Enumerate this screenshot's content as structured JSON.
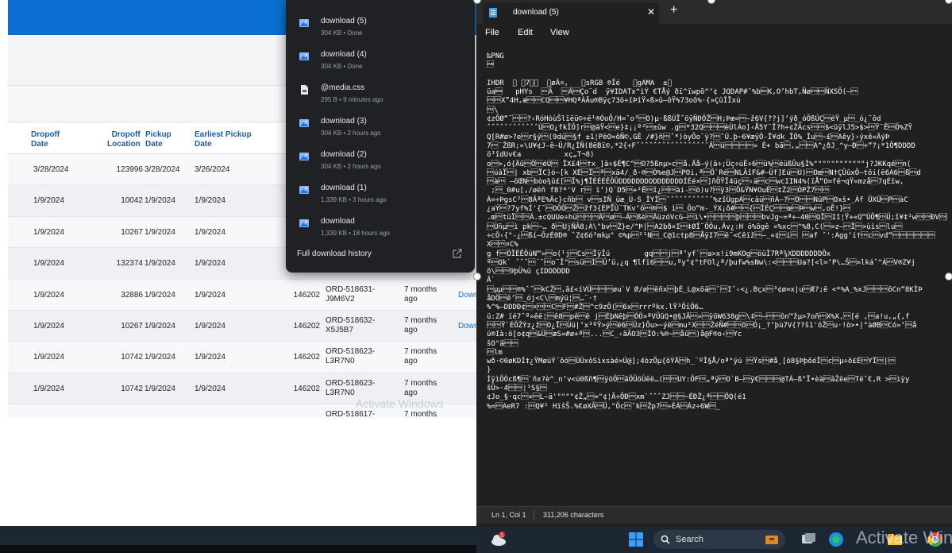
{
  "web_table": {
    "headers": {
      "dropoff_date": "Dropoff\nDate",
      "dropoff_location": "Dropoff\nLocation",
      "pickup_date": "Pickup\nDate",
      "earliest_pickup": "Earliest Pickup\nDate"
    },
    "rows": [
      {
        "dropoff_date": "3/28/2024",
        "location": "123996",
        "pickup_date": "3/28/2024",
        "earliest": "3/26/2024",
        "code": "",
        "order": "",
        "age": "",
        "action": ""
      },
      {
        "dropoff_date": "1/9/2024",
        "location": "10042",
        "pickup_date": "1/9/2024",
        "earliest": "1/9/2024",
        "code": "",
        "order": "",
        "age": "",
        "action": ""
      },
      {
        "dropoff_date": "1/9/2024",
        "location": "10267",
        "pickup_date": "1/9/2024",
        "earliest": "1/9/2024",
        "code": "",
        "order": "",
        "age": "",
        "action": ""
      },
      {
        "dropoff_date": "1/9/2024",
        "location": "132374",
        "pickup_date": "1/9/2024",
        "earliest": "1/9/2024",
        "code": "",
        "order": "",
        "age": "",
        "action": ""
      },
      {
        "dropoff_date": "1/9/2024",
        "location": "32886",
        "pickup_date": "1/9/2024",
        "earliest": "1/9/2024",
        "code": "146202",
        "order": "ORD-518631-\nJ9M6V2",
        "age": "7 months\nago",
        "action": "Down"
      },
      {
        "dropoff_date": "1/9/2024",
        "location": "10267",
        "pickup_date": "1/9/2024",
        "earliest": "1/9/2024",
        "code": "146202",
        "order": "ORD-518632-\nX5J5B7",
        "age": "7 months\nago",
        "action": "Down"
      },
      {
        "dropoff_date": "1/9/2024",
        "location": "10742",
        "pickup_date": "1/9/2024",
        "earliest": "1/9/2024",
        "code": "146202",
        "order": "ORD-518623-\nL3R7N0",
        "age": "7 months\nago",
        "action": ""
      },
      {
        "dropoff_date": "1/9/2024",
        "location": "10742",
        "pickup_date": "1/9/2024",
        "earliest": "1/9/2024",
        "code": "146202",
        "order": "ORD-518623-\nL3R7N0",
        "age": "7 months\nago",
        "action": ""
      },
      {
        "dropoff_date": "",
        "location": "",
        "pickup_date": "",
        "earliest": "",
        "code": "",
        "order": "ORD-518617-",
        "age": "7 months",
        "action": ""
      }
    ],
    "watermark": "Activate Windows"
  },
  "downloads": {
    "items": [
      {
        "name": "download (5)",
        "meta": "304 KB • Done",
        "icon": "image-file-icon"
      },
      {
        "name": "download (4)",
        "meta": "304 KB • Done",
        "icon": "image-file-icon"
      },
      {
        "name": "@media.css",
        "meta": "295 B • 9 minutes ago",
        "icon": "css-file-icon"
      },
      {
        "name": "download (3)",
        "meta": "304 KB • 2 hours ago",
        "icon": "image-file-icon"
      },
      {
        "name": "download (2)",
        "meta": "304 KB • 2 hours ago",
        "icon": "image-file-icon"
      },
      {
        "name": "download (1)",
        "meta": "1,339 KB • 3 hours ago",
        "icon": "image-file-icon"
      },
      {
        "name": "download",
        "meta": "1,339 KB • 18 hours ago",
        "icon": "image-file-icon"
      }
    ],
    "history_label": "Full download history"
  },
  "notepad": {
    "tab_title": "download (5)",
    "menu": {
      "file": "File",
      "edit": "Edit",
      "view": "View"
    },
    "content": "‰PNG\n\u001a\n\nIHDR  \u0000 \u00007\u0000\u0000  \u0000øÂ¤,   \u0000sRGB ®Îé   \u0000gAMA  ±\u000f\nüa\u0005   pHYs  \u000eÃ  \u000eÃ\u0001Ço¨d  ÿ¥IDATx^ìÝ €TÅý ðï^ïwpõ^‘¢ JQDAP#ˆ%b\u0006K,O’hbT,Ñø\u0002\u0003ÑXSÕ(–\u0002\n\u0002\u0002X”4H,æ\u0002\u0002CQ\u0002\u0003¥HQªÀÄu®Bÿç73ö÷ïÞîŸ»ß»û–ôŸ%73oõ%·{»ÇûÎÏxú\n\u0002\\\n¢zÕØ“˜\u0002\u0002?›RóHòùŠlïëü©÷ë¹®ÓoÕ/H=ˆo³\u0002O)µ·ßßÚÏˆöÿÑÐÖŽ\u0002H;Þæ=\u0002–ž6V{??j]‘ýð_óÕßÚÇ\u0002éŸ_µ\u0002_ó¿˜ôd\nˆˆˆˆˆˆˆˆˆˆˆˆÚ\u0002O¿fkÎÕ]r\u0002@äŸ<\u0002e}‡¡¡º²\u0002±ûw .g\u0002*32Q\u0002\u0002\u0001èÙlÀo]‹Å5Y¨Î?h÷¢ŽÃcs\u0002\u0002$<üÿlJ5>$>\u0002Ÿ¨Ê\u0002Ö%ZŸ\nQ[R#ø>?e\u0002r§ý\u0002(9dú\u0002§f ±1¦PèO=ôÑ©,GÊ /#}ñ\u0002ˆ*)òyÕo¨ÿ?\u0002ˆÚ.þ~6¥æÿÓ-Ï¥dk_ÏÒ%_Îu\u0002~£\u0002Aêy}›ýxê«ÂýÞ\n7\u0002¨ŽßR;«\\U¥¢J-ê—Ù/R¿ÍÑ(8ëBï©,*2{÷FˆˆˆˆˆˆˆˆˆˆˆˆˆˆˆˆˆÂ\u0002ü\u0002\u0002\u0002\u0002» È+ bã\u0002‚„\u0002\u0002A^¿ðJ_^y—Ð\u0002÷“?¡*1Ô¶DDDD\nö³îdUv€a          xç„T¬8)\no\u0002>,ó{Äû\u0002Ô\u0002éÙ\u0002 ÏX£4\u0002†x_]ä÷$É¶C^\u0002O?5ßnµ>c\u0002å.Äå–ý(ä÷;Üç÷úÊ÷6\u0002ü%\u0002éüßÛu§Í%\"\"\"\"\"\"\"\"\"\"\"\"j?JKKqé\u0002n(\n\u0002úâÏ\u0002| xb\u0002ÏC}ó~[k XÉ\u0002Ï\u0002ª\u0002xä4/_ð·®\u0002Ò%e@J\u0002POi,ª\u0002Õ`Ré\u0002NLÃîF&#–Üf]Eú\u0002Ù)\u0002Oœ\u0002N†ÇÛûxÔ–tôi(ë6A6\u0002ß\u0002d\n\u0002à\u0002 –õŒN\u0002bòo¾û£[\u0002Ï%j¶ÏÈÉÉÊÔÛDDDDDDDDDDDDDDDÍÉé×\u0002]ñÕŸÎ4üç\u0002‹ä\u0002c\u0002wcIIN4%(ïÅ“O=fë¬qŸ«mzå\u00027qÉîw,\n ;\u0002_0#u[,/øëñ f8?*'V r\u0002 ï‘)Q`D5\u0002+²Ê\u0002î¿\u0002\u0002ài-\u0002ò)u?\u0002ÿ3\u0002Ö&ŸN¥OuÊ\u0002‡Ž2\u0002ÒPŽ7\u0002\u0002\nÀ=÷ÞgsC²\u00028ÃªE%Äc}cñb\u0002 v\u0002sIÑ_üæ_Ù-S_ÎYÎ\u0002ˆˆˆˆˆˆˆˆˆˆˆ%zîÜgpÁ\u0002cäü\u0002ñÀ—?\u0002Ò\u0002\u0002NûP\u0002Oxš•_Áf ÜXÚ\u0002P\u0002àC\n¿aÝ\u0002?7yf%Í'{˜\u0002OÕÔ\u0002Ž\u0002žf3{ÈPÏÙ¨TKv‘ô\u0002®\u0002$ ì\u0002_Ôo™m-_ÝX¡ô#\u0002\u0002{\u0002ÎÉÇ\u0002\u0002œ\u0002Þ\u0002w\u0002,oÊ!}\u0002\n.œ\u0002tüÏ\u0002\u0002Á.±cQUUe÷hü\u0002\u0002\u0002Ä\u0002ø\u0002–Á\u0002ßè\u0002ÄüzóVcG–\u0002ì\\•\u0002\u0002\u0002\u0002þ\u0002\u0002\u0002bvJg~=ª+–40\u0002QÏ\u0002Iî¦Ÿ+«Q™ÙÕ¶\u0002Ü;î¥‡¹w\u0002\u0002ÐV\u0002\u0002\u0002ÖNY\n\u0002Ùñµ\u0002ì pk\u0002~… ð\u0002UjÑÃ8;À\\\"bv\u0002Ž}e/^Þ|\u0002A2bð×I\u0002‡ØÎ¨ÖÖu,Âv¿:H ö%ôgê «%xc\u0002^%8,C(\u0002=z–\u0002Ï\u0002>ùìs\u0002lu\u0002\n÷cÔ‹{°-¿\u0002ßí—ÕzÉ0D® ˆZ¢6ó²mkµ\" ©%p\u0002²¹N\u0002_C@1ctp8\u0002ÅÿI7\u0002ë¨<Cêïž\u0002—_«¢\u0002i\u0002 \u0002af ˆ':Agg‘í†\u0002c\u0002vd“\u0002\u0002\u0002\u0002\u0002\u0002\nX\u0002\u0002¤C%\ng f\u0002ÖÏÉÊÕùN™»\u0002o(¹j\u0002Cs\u0002ÏÿÎü        gq\u0002\u0002j\u0002ª‘yf`\u0002a>x!i9mKOg\u0002öüÎ7Rª¾XDDDDDDDÔx\nº\u0002Qk` ˆˆˆ\u0002´˜\u0002o˜Î\"\u0002sü\u0002Ì\u0002Û’ü,¿q ¶lfï6\u0002\u0002u,ºy\"¢°tFOl¿ª/þufw%sNw\\:<\u0002\u0002\u0002Ua?[<l=‘P\\…Š\u0002=lkáˆ^À\u0002V®Z¥j\nõ\\\u0002\u00029þÜ%ü çIDDDDDD\nÂ`\n\u0002µµ\u0002\u0002®%ˆˆ\u0002kCŽ\u0002,ã£«íVÜ\u0002\u0002\u0002øu`V Ø/ø\u0002ëñx\u0002þÉ_L@xöä\u0002ˆ\u0002Iˆ‹<¿.Bçx\u0002³¢ø=x|u\u0002Æ?;ë <*%A_%xJ\u0002\u0002\u0002ôCn“8KÌÞ\nåDÖ\u0002ê‘\u0002_ój<C\\\u0002mýü¦\u0002…¨·†\n%^%–DDDÐ¢\u0002¤\u0002\u0002C\u0002F\u0002#Ž\u0002^c9zÕ(\u00026x\u0002rrrºkx.lŸ³ÕïÕ6…\nü:Z# ïé7ˆº»êë¦\u0002ê8\u0002pê\u0002ê j\u0002ÉþNêþ\u0002ÒÖ»ªVÜûQ•@§JÄ\u0002»\u0002ÿöW638g\u0002\\‡\u0002–\u0002\u0002ôn™žµ>7oñ\u0002X%X,\u0002[é ,\u0002a!u,„{,f\n\u0002\u0002Ÿ`ÉÖŽÝz¿ž\u0002O¿Ï\u0002Ùü|‘x³ºŸ>ý\u0002ë6\u0002Ûz}Ôu>~ýë\u0002mu²X\u0002\u0002ŽéÑ#\u0002\u0002õ\u0002Ó¡_?‘þù7V{??š1'ôŽ\u0002u·!ò>•|\"àØB\u0002Có»‘\u0002å\nü®Ià:ö[o¢q\u0002&Ü\u0002æS»#ø+ª\u0002...\u0002C_‹ãÃO3\u0002ÌO:%®~\u0002åû\u0002)å@F®o‹\u0002Yc\nšO\"ä\u0002\u0002\n\u0002lm\nwð·©0øKDÍ‡¿ŸMøùÝ´ôó\u0002ÙÙxôSìxsàé×Ú@];4òzÕµ{öÝÄ\u0002h_¨ºÎ§Å/oª\"ýú \u0002Ÿs\u0002#å¸[ö8§ÞþõéÎ\u0002c\u0002µ÷õ£É\u0002YÏ\u0002|\u0002\n}\nÌÿìÖÒcß¶\u0002`ñx?è^_n‘v<ú0ßñ¶\u0002ÿöÔ\u0002ãÔÜöÚêë…(\u0002\u0002UY:ÖF\u0002„ªÿ\u0002O`B–\u0002ÿ€\u0002\u0002\u0002@TÁ–ß°Ï•èà\u0002âŽëe\u0002Tëˆ€,R >\u0002iÿy\nšÛ>·4\u0002\u0002¦¹S§\u0002\n¢Jo_§·qc\u0002×\u0002L–ä'\"\"\"\"¢Ž„\u0002=\"¢¦Ã÷ÕÐ\u0002xm`ˆˆˆZJ\u0002\u0002~ÉÐŽ¿ª\u0002\u0002ÕQ(é1\n%=\u0002AeR7 :\u0002Q¥¹ HïšŠ.%€øXÃ\u0002Ü,\"Öc\u0002ˆk\u0002Žp7\u0002÷ÉÁ\u0002Áz÷6W\u0002_",
    "status_position": "Ln 1, Col 1",
    "status_chars": "311,206 characters"
  },
  "taskbar": {
    "search_label": "Search",
    "watermark": "Activate Win"
  }
}
